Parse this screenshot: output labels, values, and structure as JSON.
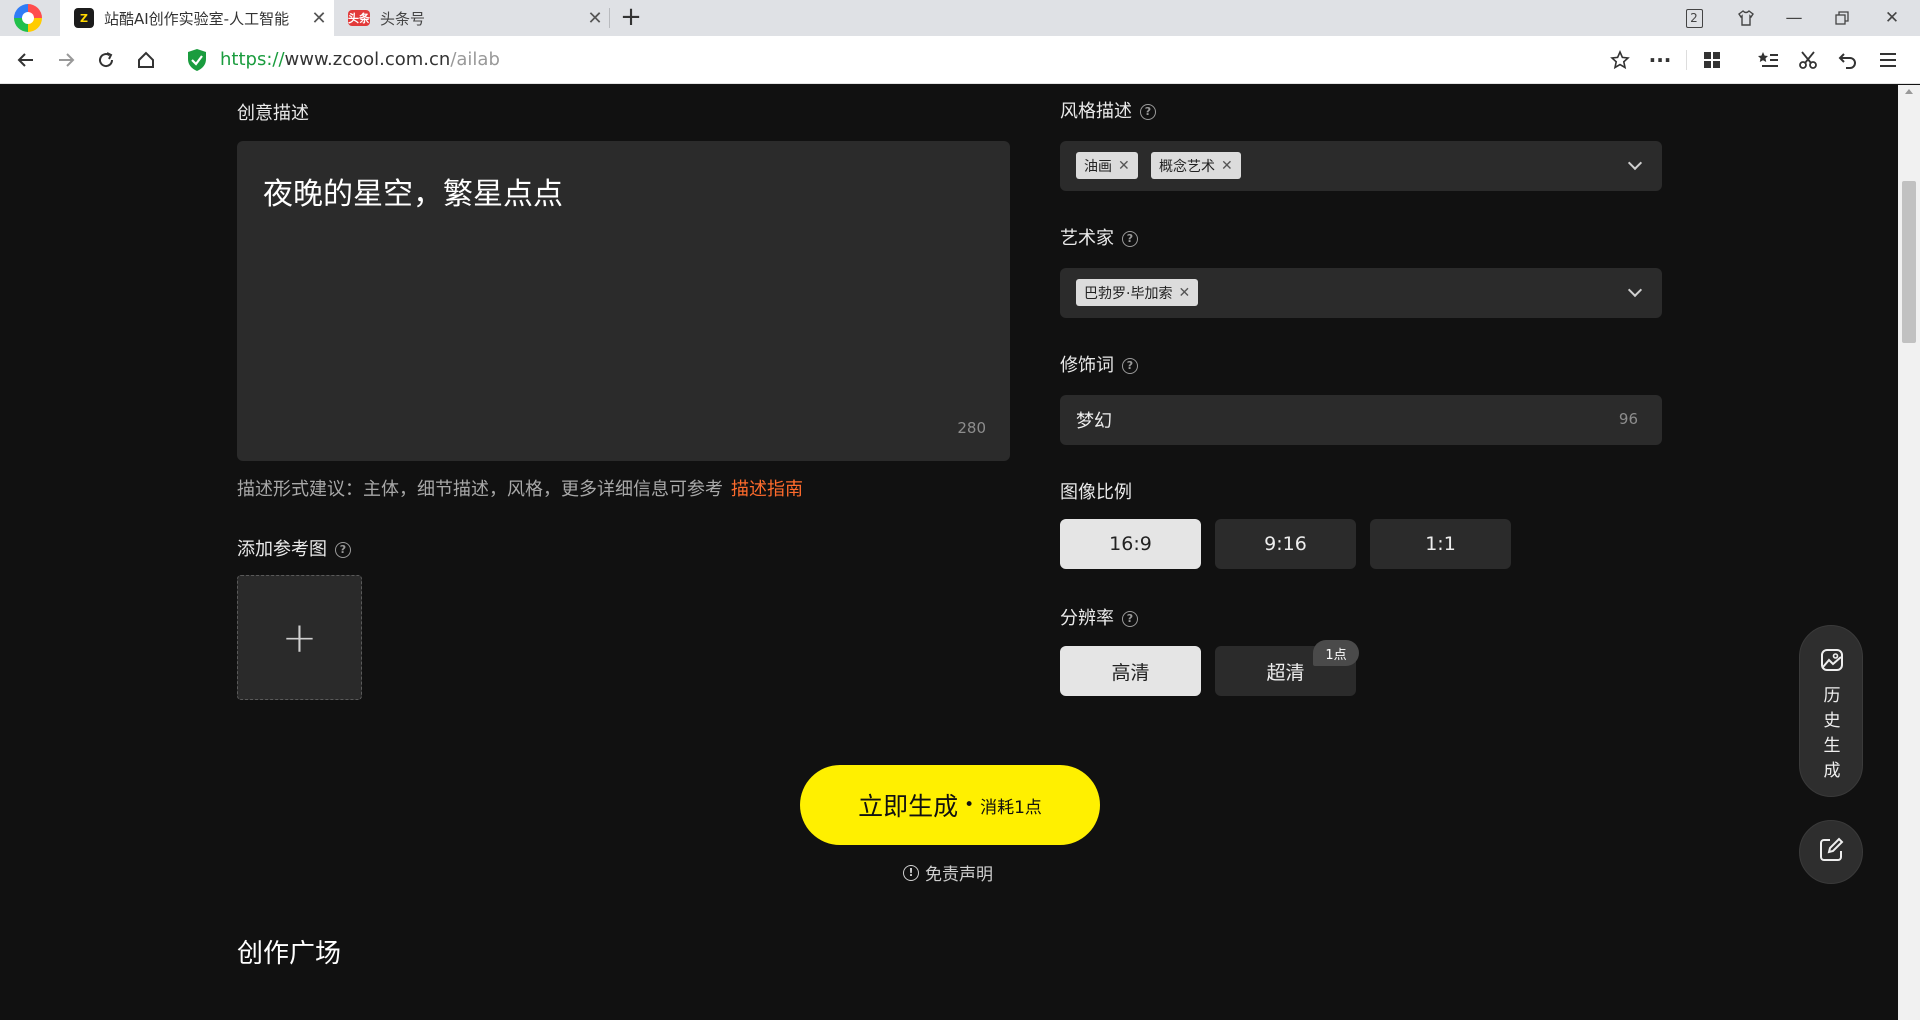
{
  "browser": {
    "tabs": [
      {
        "title": "站酷AI创作实验室-人工智能",
        "favicon": "zcool-icon",
        "active": true
      },
      {
        "title": "头条号",
        "favicon": "toutiao-icon",
        "favicon_text": "头条",
        "active": false
      }
    ],
    "window_badge": "2",
    "address": {
      "scheme": "https://",
      "host": "www.zcool.com.cn",
      "path": "/ailab"
    }
  },
  "form": {
    "prompt": {
      "label": "创意描述",
      "value": "夜晚的星空，繁星点点",
      "count": "280"
    },
    "hint": {
      "text": "描述形式建议：主体，细节描述，风格，更多详细信息可参考",
      "link": "描述指南"
    },
    "reference": {
      "label": "添加参考图",
      "add_symbol": "+"
    },
    "style": {
      "label": "风格描述",
      "tags": [
        "油画",
        "概念艺术"
      ]
    },
    "artist": {
      "label": "艺术家",
      "tags": [
        "巴勃罗·毕加索"
      ]
    },
    "modifier": {
      "label": "修饰词",
      "value": "梦幻",
      "count": "96"
    },
    "ratio": {
      "label": "图像比例",
      "options": [
        "16:9",
        "9:16",
        "1:1"
      ],
      "selected": "16:9"
    },
    "resolution": {
      "label": "分辨率",
      "options": [
        "高清",
        "超清"
      ],
      "selected": "高清",
      "premium_badge": "1点"
    }
  },
  "generate": {
    "label": "立即生成",
    "separator": "•",
    "cost": "消耗1点"
  },
  "disclaimer": "免责声明",
  "section_title": "创作广场",
  "floating": {
    "history_label": [
      "历",
      "史",
      "生",
      "成"
    ]
  },
  "colors": {
    "accent_yellow": "#fff000",
    "link_orange": "#ff6b2c",
    "page_bg": "#111111",
    "secure_green": "#1a9c3e"
  }
}
